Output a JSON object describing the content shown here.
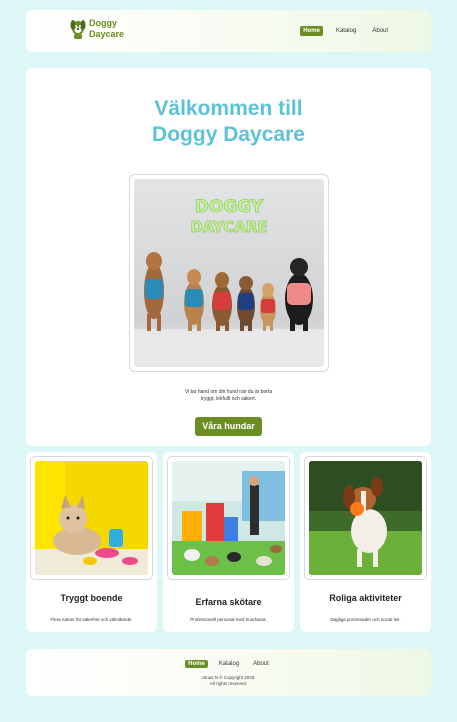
{
  "header": {
    "brand_line1": "Doggy",
    "brand_line2": "Daycare",
    "brand_icon": "dog-logo-icon",
    "nav": [
      "Home",
      "Katalog",
      "About"
    ],
    "active": "Home"
  },
  "hero": {
    "title_line1": "Välkommen till",
    "title_line2": "Doggy Daycare",
    "image_text_line1": "DOGGY",
    "image_text_line2": "DAYCARE",
    "caption_line1": "Vi tar hand om din hund när du är borta",
    "caption_line2": "tryggt, lekfullt och säkert.",
    "cta_label": "Våra hundar"
  },
  "cards": [
    {
      "title": "Tryggt boende",
      "desc": "Flera rutiner för säkerhet och välmående."
    },
    {
      "title": "Erfarna skötare",
      "desc": "Professionell personal med hundvana."
    },
    {
      "title": "Roliga aktiviteter",
      "desc": "Dagliga promenader och social lek."
    }
  ],
  "footer": {
    "nav": [
      "Home",
      "Katalog",
      "About"
    ],
    "copy_line1": "Jonas N © Copyright 2025.",
    "copy_line2": "All rights reserved."
  },
  "colors": {
    "accent": "#6b8e23",
    "title": "#5cc2d8",
    "background": "#ddf7f7"
  }
}
